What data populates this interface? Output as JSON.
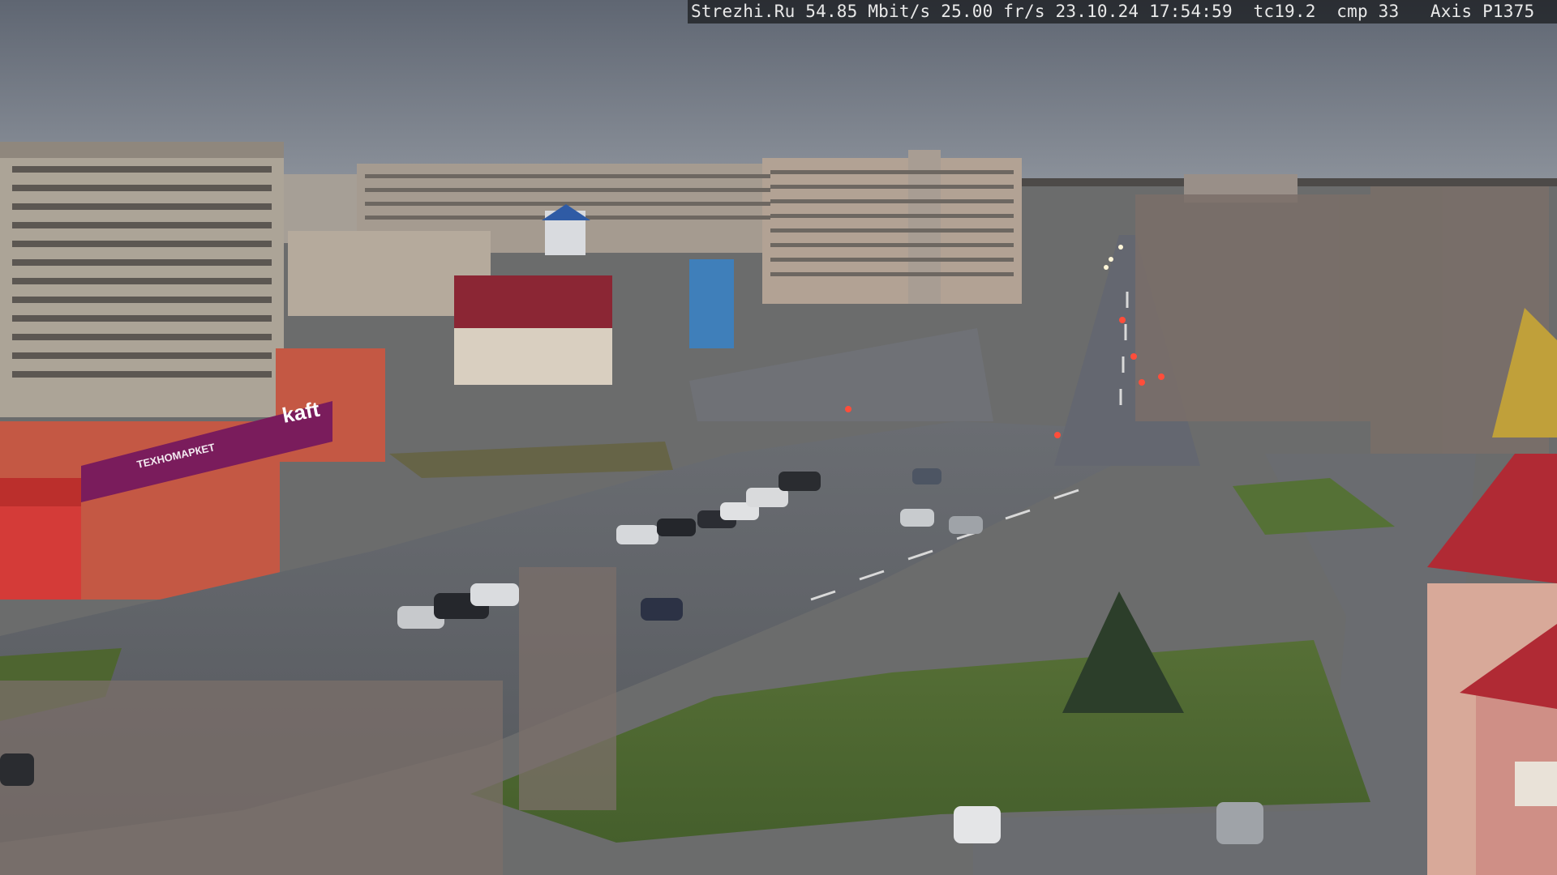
{
  "camera_overlay": {
    "text": "Strezhi.Ru 54.85 Mbit/s 25.00 fr/s 23.10.24 17:54:59  tc19.2  cmp 33   Axis P1375"
  },
  "storefront": {
    "sign_main": "kaft",
    "sign_small": "ТЕХНОМАРКЕТ"
  },
  "colors": {
    "sky_top": "#6c7380",
    "sky_horizon": "#8a919b",
    "road": "#5d6066",
    "grass": "#4f6b33",
    "brick_red": "#b8433a",
    "brand_purple": "#7a1c5c",
    "tower_roof": "#b02a34"
  }
}
